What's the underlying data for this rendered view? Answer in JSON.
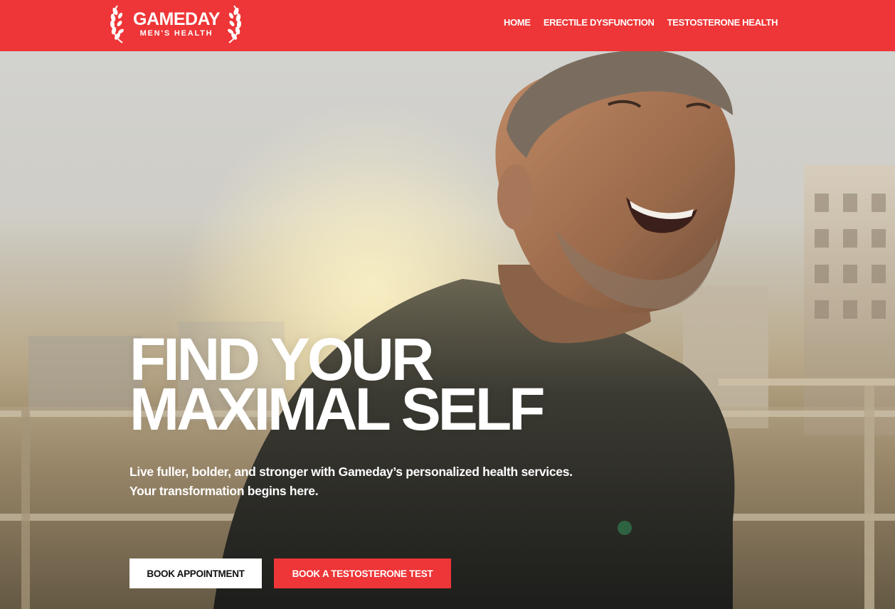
{
  "brand": {
    "name": "GAMEDAY",
    "tagline": "MEN'S HEALTH",
    "primary_color": "#ee3537",
    "logo_icon": "laurel-wreath-icon"
  },
  "nav": {
    "items": [
      {
        "label": "HOME"
      },
      {
        "label": "ERECTILE DYSFUNCTION"
      },
      {
        "label": "TESTOSTERONE HEALTH"
      }
    ]
  },
  "hero": {
    "image": "smiling-man-rooftop-photo",
    "title_line1": "FIND YOUR",
    "title_line2": "MAXIMAL SELF",
    "subtitle": "Live fuller, bolder, and stronger with Gameday’s personalized health services. Your transformation begins here.",
    "cta_primary": "BOOK APPOINTMENT",
    "cta_secondary": "BOOK A TESTOSTERONE TEST"
  }
}
